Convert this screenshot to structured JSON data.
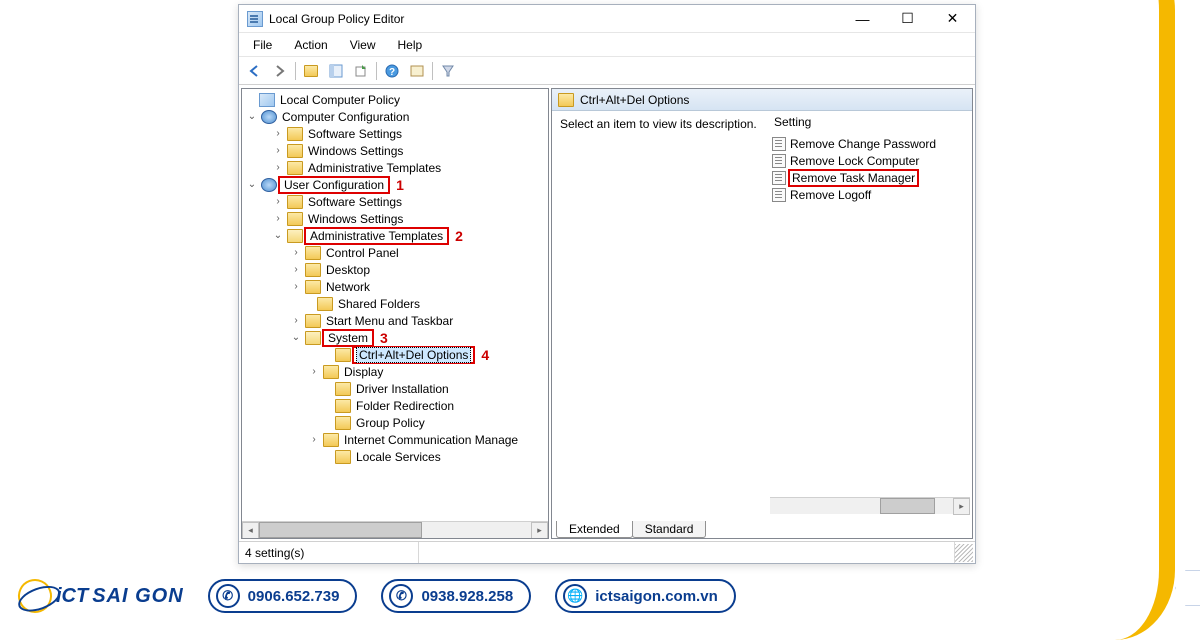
{
  "window": {
    "title": "Local Group Policy Editor",
    "menu": [
      "File",
      "Action",
      "View",
      "Help"
    ]
  },
  "tree": {
    "root": "Local Computer Policy",
    "computer_conf": "Computer Configuration",
    "cc_software": "Software Settings",
    "cc_windows": "Windows Settings",
    "cc_admin": "Administrative Templates",
    "user_conf": "User Configuration",
    "uc_software": "Software Settings",
    "uc_windows": "Windows Settings",
    "uc_admin": "Administrative Templates",
    "control_panel": "Control Panel",
    "desktop": "Desktop",
    "network": "Network",
    "shared": "Shared Folders",
    "startmenu": "Start Menu and Taskbar",
    "system": "System",
    "ctrlaltdel": "Ctrl+Alt+Del Options",
    "display": "Display",
    "driver": "Driver Installation",
    "folder_redir": "Folder Redirection",
    "group_policy": "Group Policy",
    "internet_comm": "Internet Communication Manage",
    "locale": "Locale Services"
  },
  "annotations": {
    "a1": "1",
    "a2": "2",
    "a3": "3",
    "a4": "4"
  },
  "right": {
    "header": "Ctrl+Alt+Del Options",
    "description": "Select an item to view its description.",
    "col_header": "Setting",
    "settings": [
      "Remove Change Password",
      "Remove Lock Computer",
      "Remove Task Manager",
      "Remove Logoff"
    ]
  },
  "tabs": {
    "extended": "Extended",
    "standard": "Standard"
  },
  "status": "4 setting(s)",
  "footer": {
    "brand1": "iCT",
    "brand2": "SAI GON",
    "phone1": "0906.652.739",
    "phone2": "0938.928.258",
    "web": "ictsaigon.com.vn"
  }
}
